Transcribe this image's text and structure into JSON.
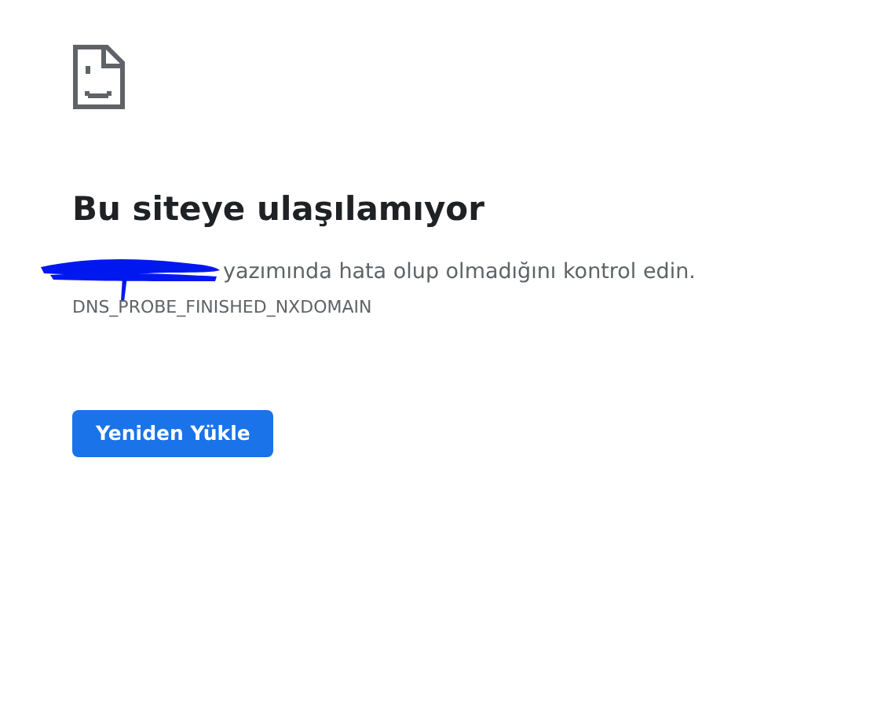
{
  "heading": "Bu siteye ulaşılamıyor",
  "message": "yazımında hata olup olmadığını kontrol edin.",
  "error_code": "DNS_PROBE_FINISHED_NXDOMAIN",
  "buttons": [
    "Yeniden Yükle"
  ]
}
